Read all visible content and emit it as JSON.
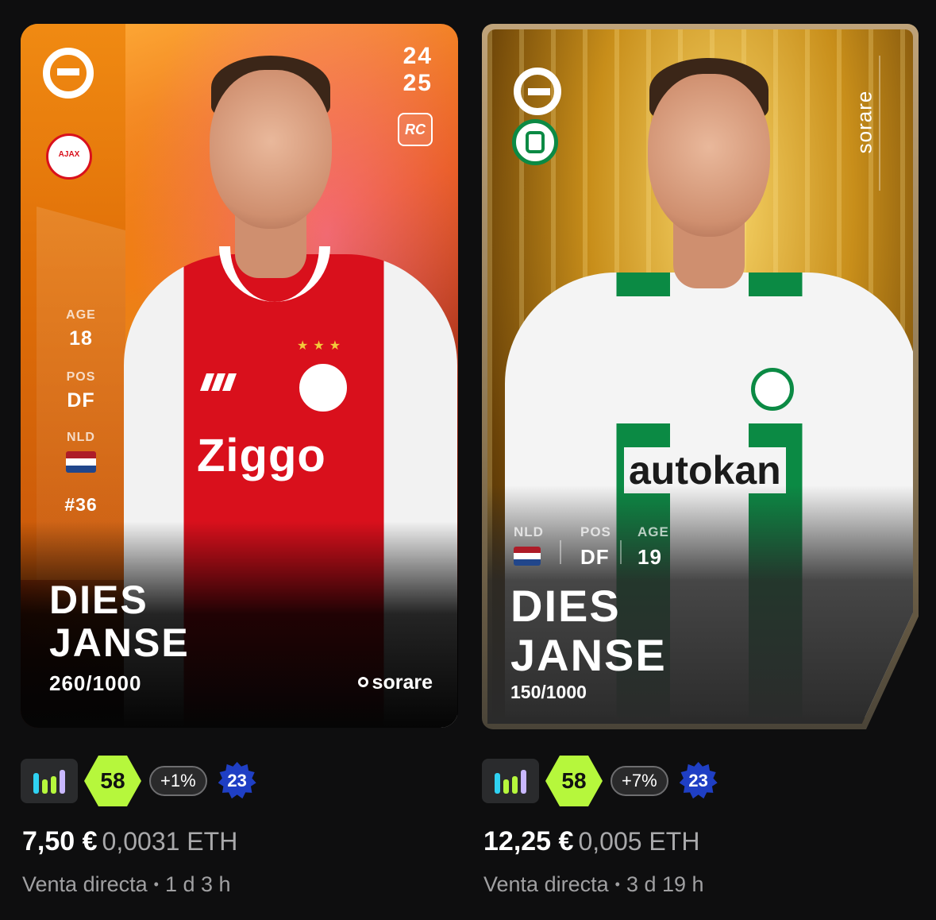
{
  "listings": [
    {
      "card": {
        "season_top": "24",
        "season_bottom": "25",
        "rookie_badge": "RC",
        "age_label": "AGE",
        "age": "18",
        "pos_label": "POS",
        "position": "DF",
        "nationality": "NLD",
        "number": "#36",
        "first_name": "DIES",
        "last_name": "JANSE",
        "serial": "260/1000",
        "brand": "sorare",
        "jersey_sponsor": "Ziggo",
        "club_badge_text": "AJAX"
      },
      "score": "58",
      "delta": "+1%",
      "level": "23",
      "price_eur": "7,50 €",
      "price_eth": "0,0031 ETH",
      "sale_type": "Venta directa",
      "time_left": "1 d 3 h"
    },
    {
      "card": {
        "nationality": "NLD",
        "pos_label": "POS",
        "position": "DF",
        "age_label": "AGE",
        "age": "19",
        "first_name": "DIES",
        "last_name": "JANSE",
        "serial": "150/1000",
        "brand": "sorare",
        "jersey_sponsor": "autokan"
      },
      "score": "58",
      "delta": "+7%",
      "level": "23",
      "price_eur": "12,25 €",
      "price_eth": "0,005 ETH",
      "sale_type": "Venta directa",
      "time_left": "3 d 19 h"
    }
  ],
  "colors": {
    "background": "#0e0e0f",
    "score_green": "#b6f73c",
    "level_blue": "#1f3fc4",
    "muted_text": "#a0a0a2"
  },
  "icons": [
    "eredivisie-logo-icon",
    "club-badge-icon",
    "netherlands-flag-icon",
    "sorare-logo-icon",
    "performance-bars-icon",
    "level-badge-icon"
  ]
}
